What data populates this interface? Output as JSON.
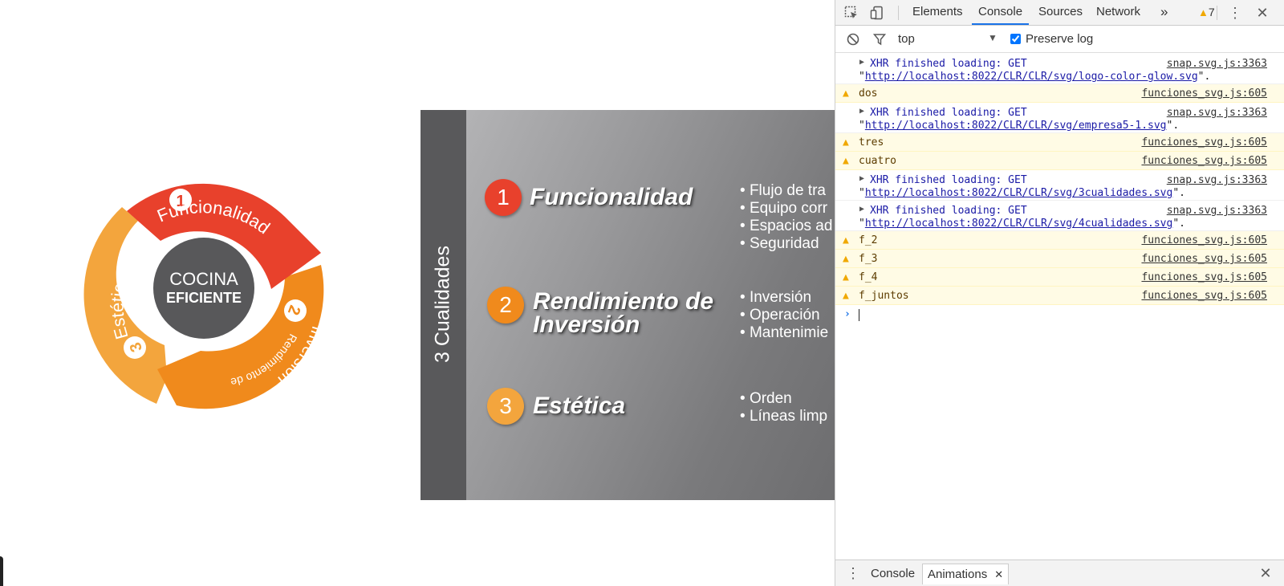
{
  "wheel": {
    "center_line1": "COCINA",
    "center_line2": "EFICIENTE",
    "seg1_text": "Funcionalidad",
    "seg1_num": "1",
    "seg2_num": "2",
    "seg2_text_a": "Inversión",
    "seg2_text_b": "Rendimiento de",
    "seg3_num": "3",
    "seg3_text": "Estética",
    "colors": {
      "red": "#e8412c",
      "orange": "#f08a1c",
      "light_orange": "#f3a53d",
      "center": "#58585a"
    }
  },
  "panel": {
    "side_title": "3 Cualidades",
    "items": [
      {
        "num": "1",
        "title_line1": "Funcionalidad",
        "title_line2": "",
        "color": "#e8412c",
        "bullets": [
          "Flujo de tra",
          "Equipo corr",
          "Espacios ad",
          "Seguridad"
        ]
      },
      {
        "num": "2",
        "title_line1": "Rendimiento de",
        "title_line2": "Inversión",
        "color": "#f08a1c",
        "bullets": [
          "Inversión",
          "Operación",
          "Mantenimie"
        ]
      },
      {
        "num": "3",
        "title_line1": "Estética",
        "title_line2": "",
        "color": "#f3a53d",
        "bullets": [
          "Orden",
          "Líneas limp"
        ]
      }
    ]
  },
  "devtools": {
    "tabs": [
      "Elements",
      "Console",
      "Sources",
      "Network"
    ],
    "active_tab": "Console",
    "more_tabs": "»",
    "warning_count": "7",
    "context": "top",
    "preserve_log_label": "Preserve log",
    "preserve_log_checked": true,
    "messages": [
      {
        "type": "xhr",
        "line1": "XHR finished loading: GET",
        "url": "http://localhost:8022/CLR/CLR/svg/logo-color-glow.svg",
        "src": "snap.svg.js:3363"
      },
      {
        "type": "warn",
        "text": "dos",
        "src": "funciones_svg.js:605"
      },
      {
        "type": "xhr",
        "line1": "XHR finished loading: GET",
        "url": "http://localhost:8022/CLR/CLR/svg/empresa5-1.svg",
        "src": "snap.svg.js:3363"
      },
      {
        "type": "warn",
        "text": "tres",
        "src": "funciones_svg.js:605"
      },
      {
        "type": "warn",
        "text": "cuatro",
        "src": "funciones_svg.js:605"
      },
      {
        "type": "xhr",
        "line1": "XHR finished loading: GET",
        "url": "http://localhost:8022/CLR/CLR/svg/3cualidades.svg",
        "src": "snap.svg.js:3363"
      },
      {
        "type": "xhr",
        "line1": "XHR finished loading: GET",
        "url": "http://localhost:8022/CLR/CLR/svg/4cualidades.svg",
        "src": "snap.svg.js:3363"
      },
      {
        "type": "warn",
        "text": "f_2",
        "src": "funciones_svg.js:605"
      },
      {
        "type": "warn",
        "text": "f_3",
        "src": "funciones_svg.js:605"
      },
      {
        "type": "warn",
        "text": "f_4",
        "src": "funciones_svg.js:605"
      },
      {
        "type": "warn",
        "text": "f_juntos",
        "src": "funciones_svg.js:605"
      }
    ],
    "drawer_tabs": [
      "Console",
      "Animations"
    ],
    "drawer_active": "Animations"
  }
}
